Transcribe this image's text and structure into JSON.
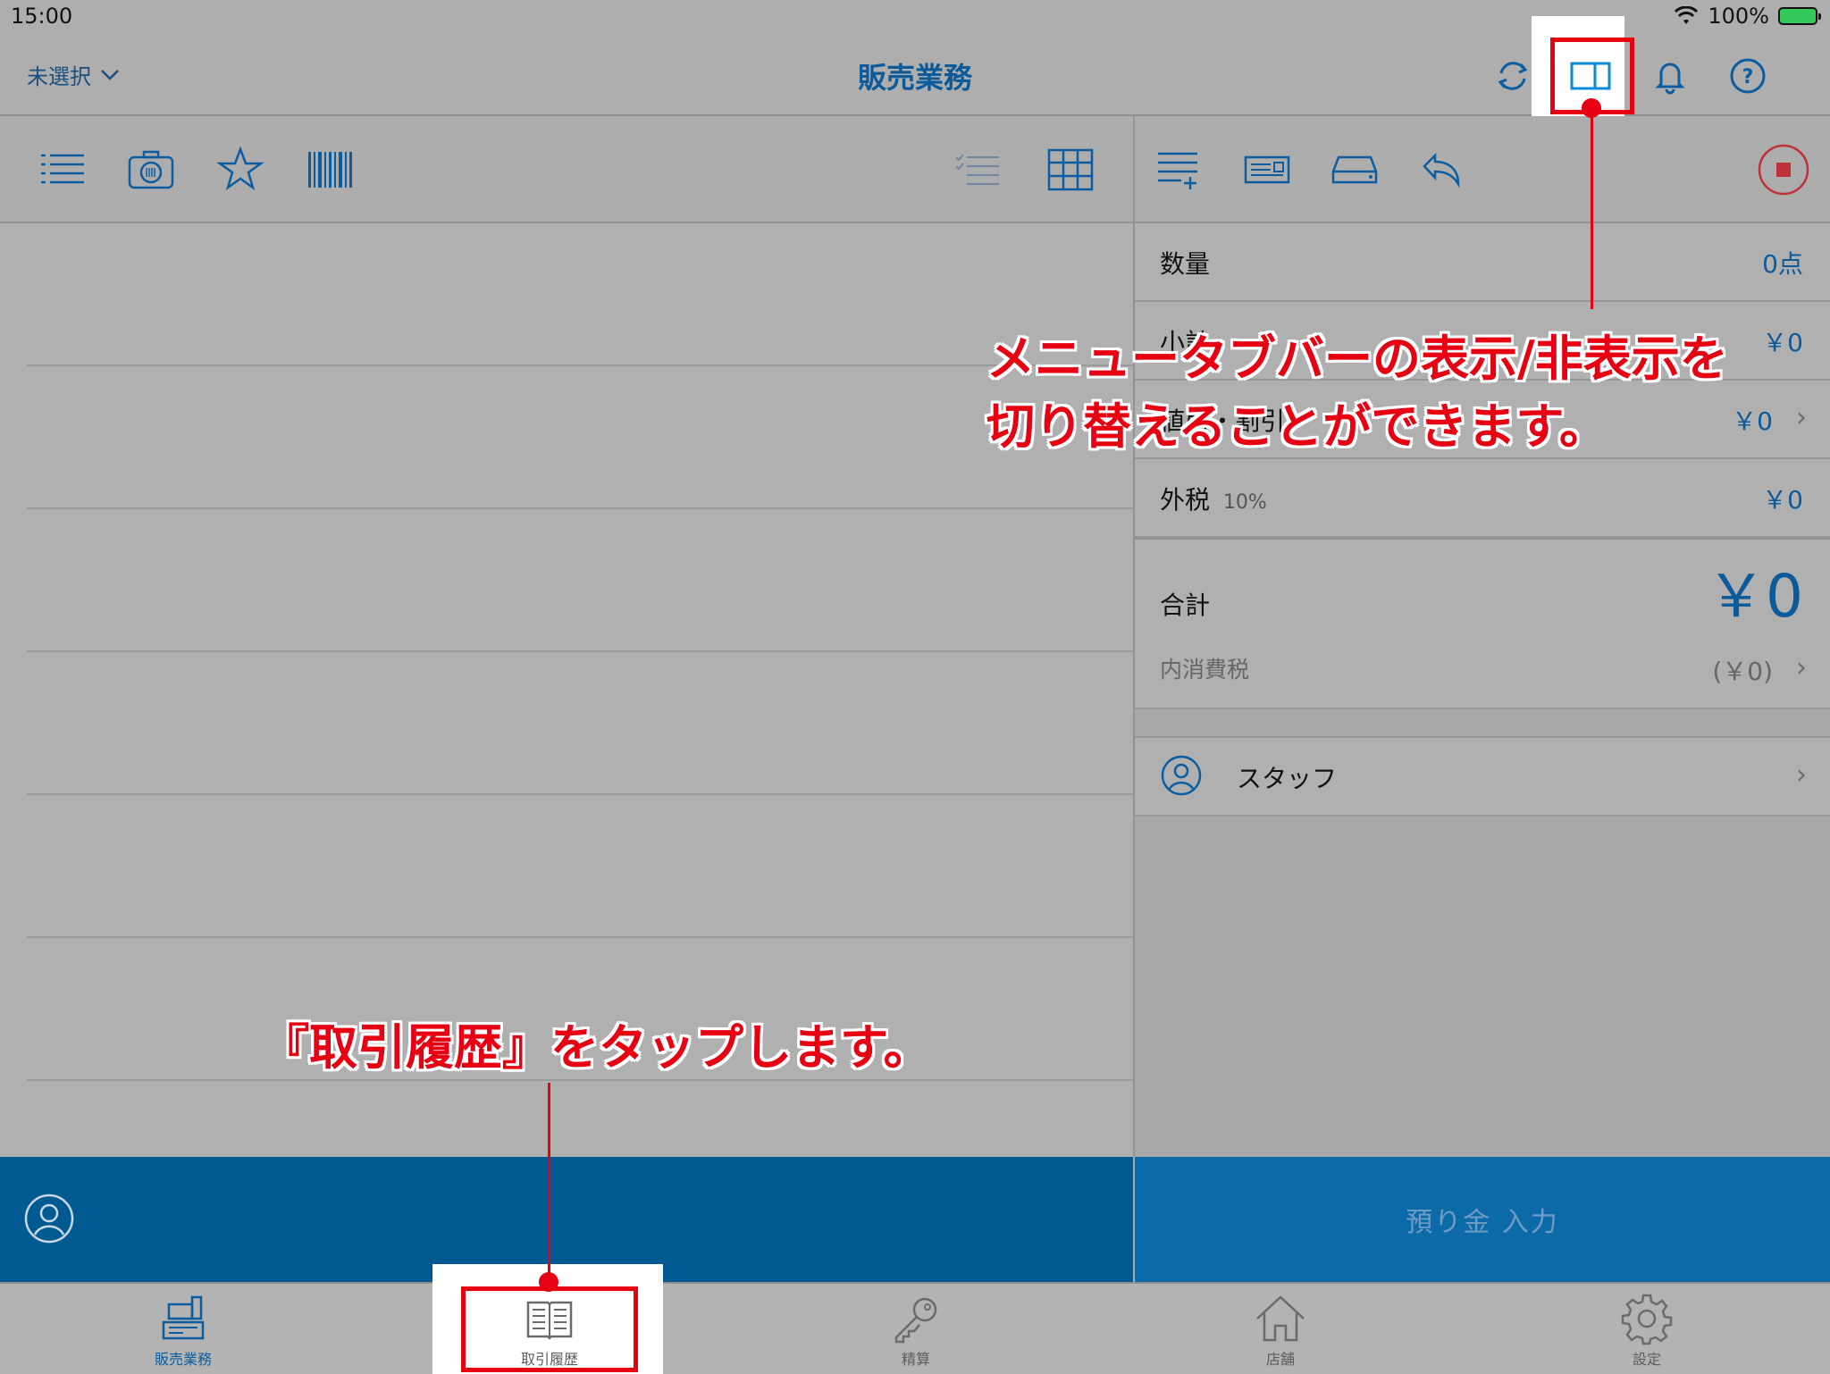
{
  "status_bar": {
    "time": "15:00",
    "battery": "100%"
  },
  "nav": {
    "store_select": "未選択",
    "title": "販売業務",
    "icons": [
      "sync-icon",
      "sidebar-toggle-icon",
      "bell-icon",
      "help-icon"
    ]
  },
  "left_toolbar": {
    "icons": [
      "list-icon",
      "camera-icon",
      "star-icon",
      "barcode-icon",
      "checklist-icon",
      "grid-icon"
    ]
  },
  "right_toolbar": {
    "icons": [
      "add-list-icon",
      "receipt-icon",
      "drawer-icon",
      "return-icon",
      "stop-icon"
    ]
  },
  "summary": {
    "quantity_label": "数量",
    "quantity_value": "0点",
    "subtotal_label": "小計",
    "subtotal_value": "￥0",
    "discount_label": "値引・割引",
    "discount_value": "￥0",
    "tax_label": "外税",
    "tax_rate": "10%",
    "tax_value": "￥0",
    "total_label": "合計",
    "total_value": "￥0",
    "inner_tax_label": "内消費税",
    "inner_tax_value": "(￥0)",
    "staff_label": "スタッフ"
  },
  "deposit_button": "預り金 入力",
  "tabs": [
    {
      "label": "販売業務",
      "icon": "register-icon",
      "active": true
    },
    {
      "label": "取引履歴",
      "icon": "book-icon",
      "active": false
    },
    {
      "label": "精算",
      "icon": "key-icon",
      "active": false
    },
    {
      "label": "店舗",
      "icon": "home-icon",
      "active": false
    },
    {
      "label": "設定",
      "icon": "gear-icon",
      "active": false
    }
  ],
  "annotations": {
    "top_line1": "メニュータブバーの表示/非表示を",
    "top_line2": "切り替えることができます。",
    "bottom": "『取引履歴』をタップします。"
  },
  "colors": {
    "accent": "#0b5da0",
    "highlight_red": "#e60012",
    "action_blue": "#005a92"
  }
}
